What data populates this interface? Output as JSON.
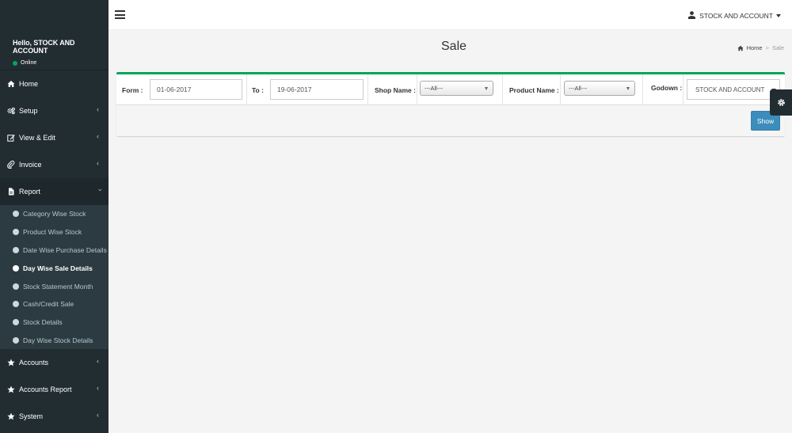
{
  "sidebar": {
    "user_name": "Hello, STOCK AND ACCOUNT",
    "status": "Online",
    "menu": [
      {
        "label": "Home",
        "icon": "home-icon"
      },
      {
        "label": "Setup",
        "icon": "gears-icon"
      },
      {
        "label": "View & Edit",
        "icon": "edit-icon"
      },
      {
        "label": "Invoice",
        "icon": "paperclip-icon"
      },
      {
        "label": "Report",
        "icon": "file-icon"
      },
      {
        "label": "Accounts",
        "icon": "star-icon"
      },
      {
        "label": "Accounts Report",
        "icon": "star-icon"
      },
      {
        "label": "System",
        "icon": "star-icon"
      }
    ],
    "report_submenu": [
      "Category Wise Stock",
      "Product Wise Stock",
      "Date Wise Purchase Details",
      "Day Wise Sale Details",
      "Stock Statement Month",
      "Cash/Credit Sale",
      "Stock Details",
      "Day Wise Stock Details"
    ],
    "active_submenu": "Day Wise Sale Details"
  },
  "header": {
    "user_label": "STOCK AND ACCOUNT"
  },
  "page": {
    "title": "Sale",
    "breadcrumb_home": "Home",
    "breadcrumb_current": "Sale"
  },
  "filters": {
    "from_label": "Form :",
    "from_value": "01-06-2017",
    "to_label": "To :",
    "to_value": "19-06-2017",
    "shop_label": "Shop Name :",
    "shop_value": "---All---",
    "product_label": "Product Name :",
    "product_value": "---All---",
    "godown_label": "Godown :",
    "godown_value": "STOCK AND ACCOUNT",
    "show_button": "Show"
  },
  "colors": {
    "sidebar_bg": "#222d32",
    "accent_green": "#00a65a",
    "button_blue": "#3c8dbc"
  }
}
